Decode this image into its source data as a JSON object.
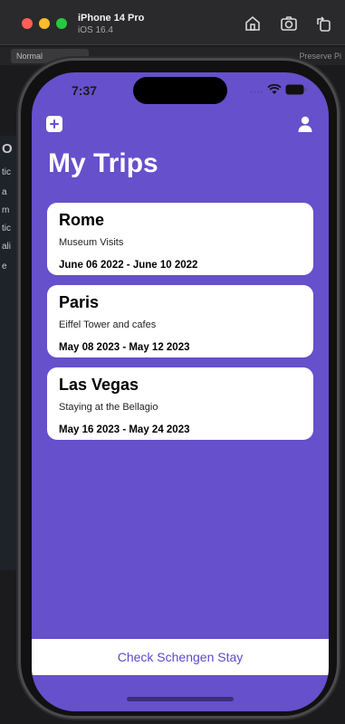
{
  "simulator": {
    "device_name": "iPhone 14 Pro",
    "os_version": "iOS 16.4",
    "home_icon": "home-icon",
    "screenshot_icon": "screenshot-icon",
    "rotate_icon": "rotate-icon"
  },
  "behind": {
    "tab_label": "Normal",
    "right_label": "Preserve Pi",
    "left_text": [
      "O",
      "tic",
      "a",
      "m",
      "tic",
      "ali",
      "e"
    ]
  },
  "status_bar": {
    "time": "7:37",
    "signal": "....",
    "wifi_icon": "wifi-icon",
    "battery_icon": "battery-icon"
  },
  "nav": {
    "add_icon": "plus-square-icon",
    "profile_icon": "person-icon"
  },
  "page": {
    "title": "My Trips"
  },
  "trips": [
    {
      "name": "Rome",
      "description": "Museum Visits",
      "dates": "June 06 2022 - June 10 2022"
    },
    {
      "name": "Paris",
      "description": "Eiffel Tower and cafes",
      "dates": "May 08 2023 - May 12 2023"
    },
    {
      "name": "Las Vegas",
      "description": "Staying at the Bellagio",
      "dates": "May 16 2023 - May 24 2023"
    }
  ],
  "bottom": {
    "schengen_label": "Check Schengen Stay"
  },
  "colors": {
    "background": "#6650cc",
    "accent": "#5b49c8",
    "card": "#ffffff"
  }
}
